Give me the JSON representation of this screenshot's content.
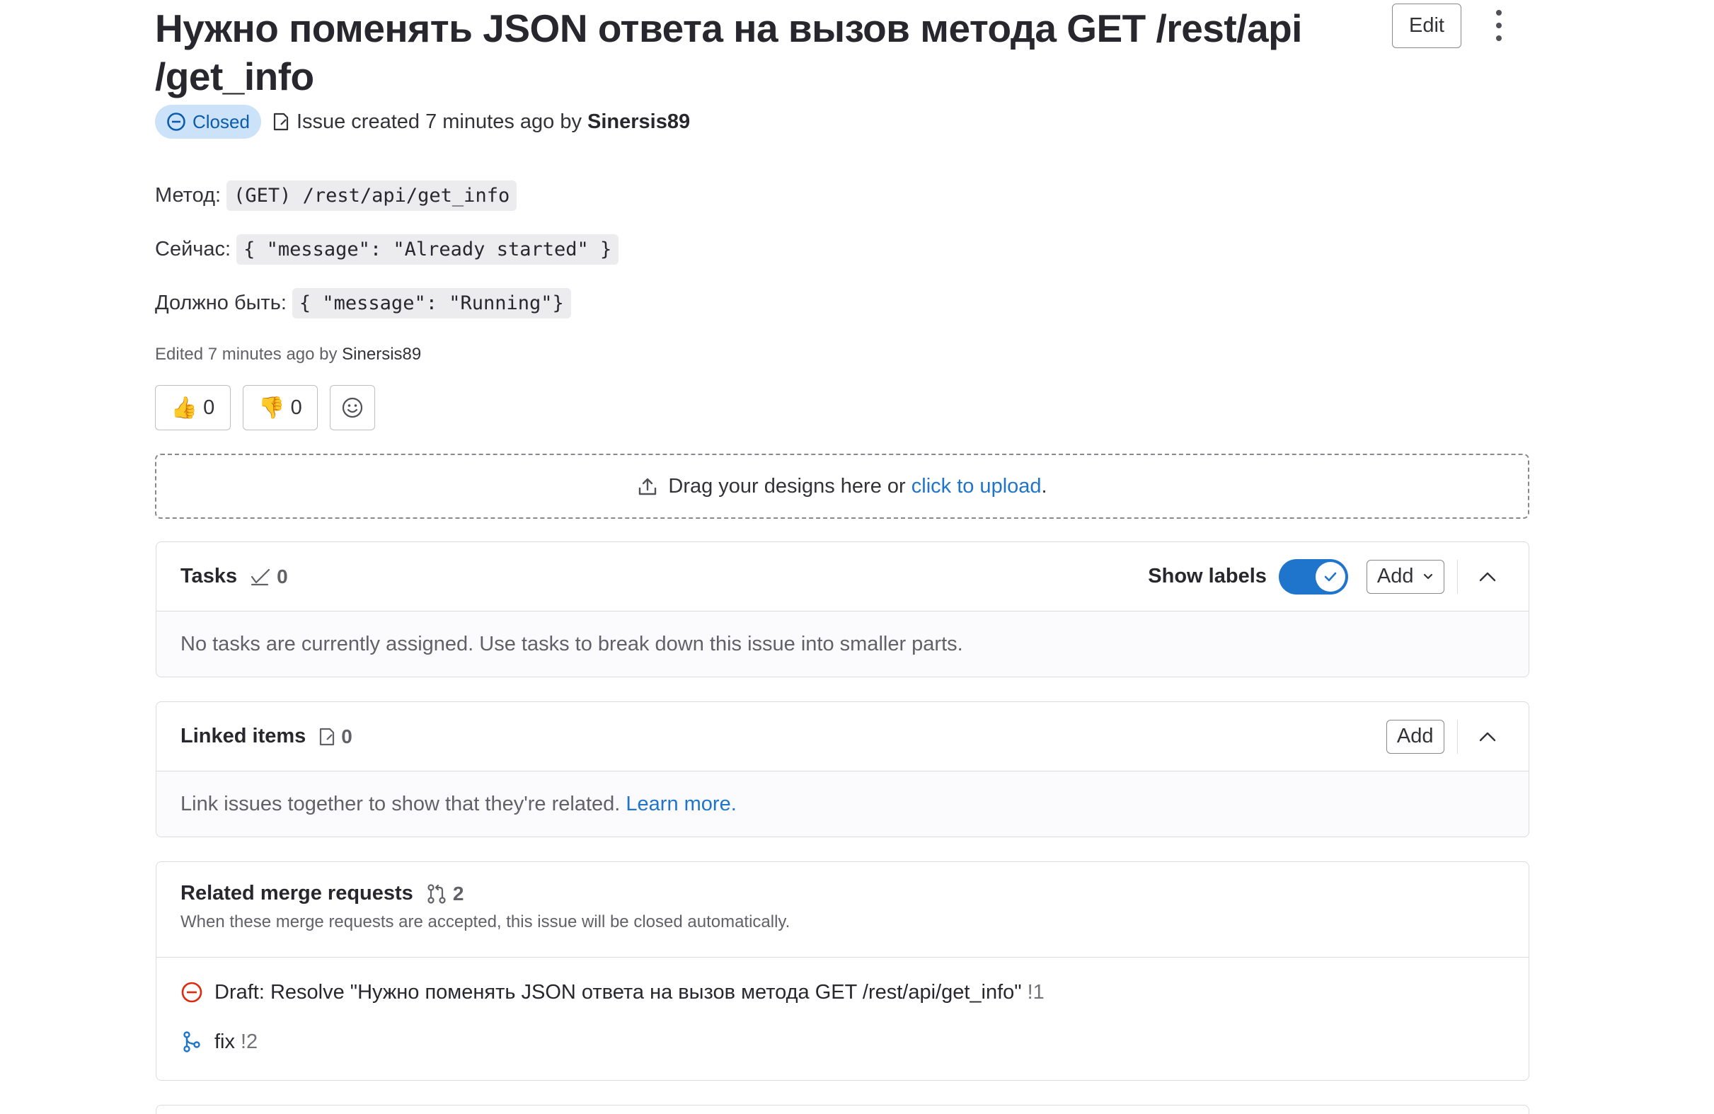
{
  "issue": {
    "title": "Нужно поменять JSON ответа на вызов метода GET /rest/api /get_info",
    "status": "Closed",
    "created_text": "Issue created 7 minutes ago by",
    "author": "Sinersis89",
    "edit_label": "Edit"
  },
  "description": {
    "lines": [
      {
        "label": "Метод:",
        "code": "(GET) /rest/api/get_info"
      },
      {
        "label": "Сейчас:",
        "code": "{ \"message\": \"Already started\" }"
      },
      {
        "label": "Должно быть:",
        "code": "{ \"message\": \"Running\"}"
      }
    ],
    "edited_text": "Edited 7 minutes ago by",
    "edited_by": "Sinersis89"
  },
  "reactions": {
    "thumbs_up": {
      "emoji": "👍",
      "count": "0"
    },
    "thumbs_down": {
      "emoji": "👎",
      "count": "0"
    }
  },
  "upload": {
    "text": "Drag your designs here or",
    "link": "click to upload",
    "suffix": "."
  },
  "tasks": {
    "title": "Tasks",
    "count": "0",
    "show_labels": "Show labels",
    "show_labels_on": true,
    "add_label": "Add",
    "empty_text": "No tasks are currently assigned. Use tasks to break down this issue into smaller parts."
  },
  "linked_items": {
    "title": "Linked items",
    "count": "0",
    "add_label": "Add",
    "empty_text": "Link issues together to show that they're related.",
    "learn_more": "Learn more."
  },
  "related_mrs": {
    "title": "Related merge requests",
    "count": "2",
    "subtitle": "When these merge requests are accepted, this issue will be closed automatically.",
    "items": [
      {
        "title": "Draft: Resolve \"Нужно поменять JSON ответа на вызов метода GET /rest/api/get_info\"",
        "ref": "!1",
        "state_icon": "closed-icon",
        "state_color": "#dd2b0e"
      },
      {
        "title": "fix",
        "ref": "!2",
        "state_icon": "merge-request-icon",
        "state_color": "#1f75cb"
      }
    ]
  },
  "colors": {
    "accent": "#1f75cb",
    "closed_badge_bg": "#cbe2f9",
    "closed_badge_text": "#0b5cad",
    "danger": "#dd2b0e"
  }
}
